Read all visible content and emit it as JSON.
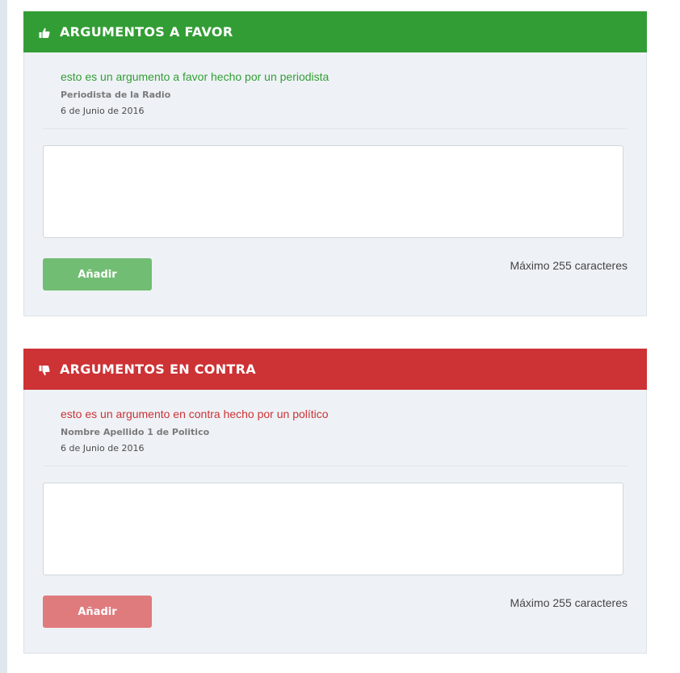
{
  "favor": {
    "title": "ARGUMENTOS A FAVOR",
    "icon": "thumbs-up-icon",
    "color": "#339d35",
    "argument": {
      "text": "esto es un argumento a favor hecho por un periodista",
      "author": "Periodista de la Radio",
      "date": "6 de Junio de 2016"
    },
    "textarea_value": "",
    "button_label": "Añadir",
    "max_label": "Máximo 255 caracteres"
  },
  "contra": {
    "title": "ARGUMENTOS EN CONTRA",
    "icon": "thumbs-down-icon",
    "color": "#cd3235",
    "argument": {
      "text": "esto es un argumento en contra hecho por un político",
      "author": "Nombre Apellido 1 de Politico",
      "date": "6 de Junio de 2016"
    },
    "textarea_value": "",
    "button_label": "Añadir",
    "max_label": "Máximo 255 caracteres"
  }
}
